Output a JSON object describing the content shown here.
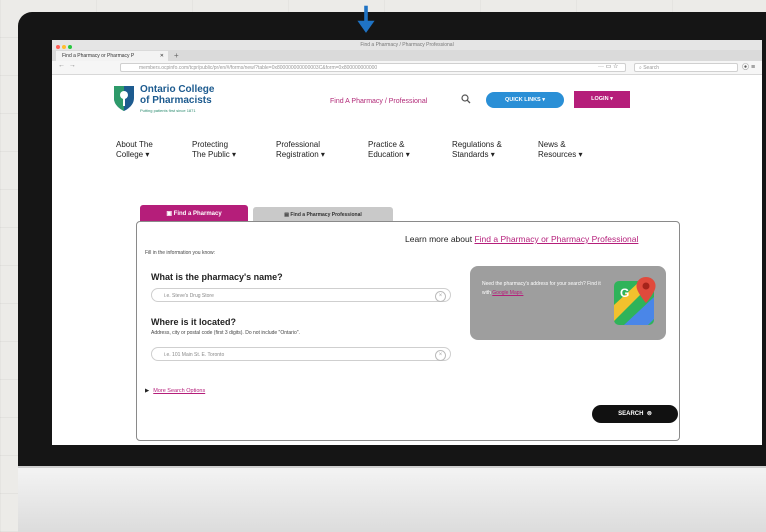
{
  "browser": {
    "window_title": "Find a Pharmacy / Pharmacy Professional",
    "tab_title": "Find a Pharmacy or Pharmacy P",
    "url": "members.ocpinfo.com/tcpr/public/pr/en/#/forms/new/?table=0x800000000000003C&form=0x800000000000",
    "search_placeholder": "Search"
  },
  "site": {
    "logo_line1": "Ontario College",
    "logo_line2": "of Pharmacists",
    "logo_tagline": "Putting patients first since 1871",
    "find_link": "Find A Pharmacy / Professional",
    "quick_links": "QUICK LINKS ▾",
    "login": "LOGIN ▾",
    "nav": [
      {
        "line1": "About The",
        "line2": "College ▾"
      },
      {
        "line1": "Protecting",
        "line2": "The Public ▾"
      },
      {
        "line1": "Professional",
        "line2": "Registration ▾"
      },
      {
        "line1": "Practice &",
        "line2": "Education ▾"
      },
      {
        "line1": "Regulations &",
        "line2": "Standards ▾"
      },
      {
        "line1": "News &",
        "line2": "Resources ▾"
      }
    ]
  },
  "search": {
    "tab_pharmacy": "Find a Pharmacy",
    "tab_professional": "Find a Pharmacy Professional",
    "learn_prefix": "Learn more about ",
    "learn_link": "Find a Pharmacy or Pharmacy Professional",
    "fill_info": "Fill in the information you know:",
    "name_question": "What is the pharmacy's name?",
    "name_placeholder": "i.e. Steve's Drug Store",
    "location_question": "Where is it located?",
    "location_hint": "Address, city or postal code (first 3 digits). Do not include \"Ontario\".",
    "location_placeholder": "i.e. 101 Main St. E. Toronto",
    "map_text": "Need the pharmacy's address for your search? Find it with ",
    "map_link": "Google Maps.",
    "more_options": "More Search Options",
    "search_button": "SEARCH"
  },
  "colors": {
    "brand_magenta": "#b51e7a",
    "brand_blue": "#2a8fd6",
    "arrow_blue": "#1f73c4"
  }
}
